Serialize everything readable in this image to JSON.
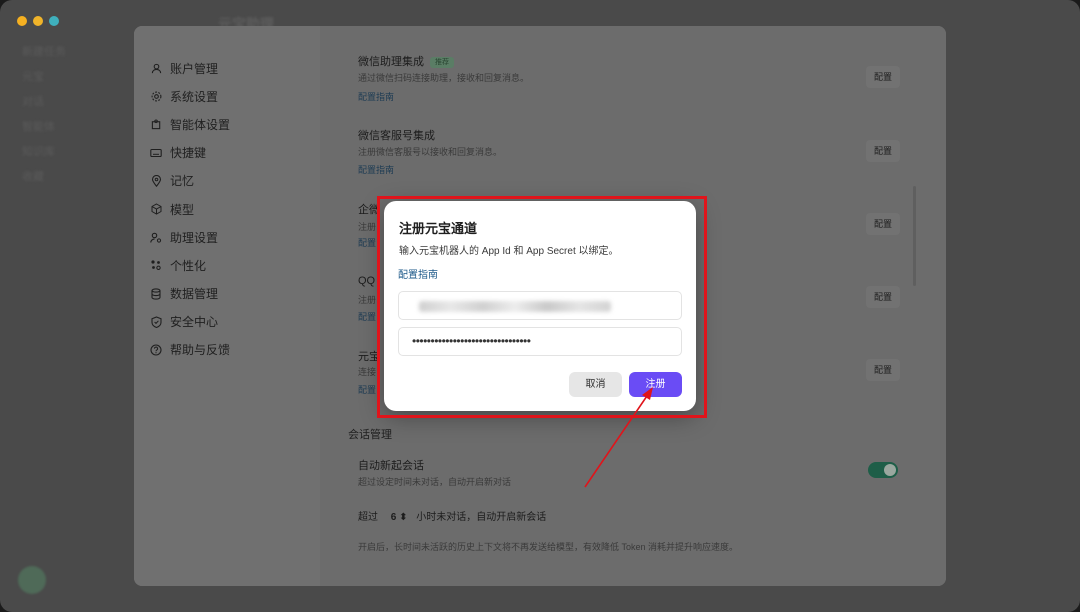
{
  "window": {
    "traffic_lights": [
      "#f5b021",
      "#f0b42a",
      "#3fb0bd"
    ],
    "title": "元宝助理"
  },
  "background_sidebar": {
    "items": [
      "新建任务",
      "元宝",
      "对话",
      "智能体",
      "知识库",
      "收藏",
      "",
      ""
    ]
  },
  "settings": {
    "nav": [
      {
        "icon": "user-icon",
        "label": "账户管理"
      },
      {
        "icon": "gear-icon",
        "label": "系统设置"
      },
      {
        "icon": "puzzle-icon",
        "label": "智能体设置"
      },
      {
        "icon": "keyboard-icon",
        "label": "快捷键"
      },
      {
        "icon": "pin-icon",
        "label": "记忆"
      },
      {
        "icon": "cube-icon",
        "label": "模型"
      },
      {
        "icon": "assistant-icon",
        "label": "助理设置"
      },
      {
        "icon": "palette-icon",
        "label": "个性化"
      },
      {
        "icon": "database-icon",
        "label": "数据管理"
      },
      {
        "icon": "shield-icon",
        "label": "安全中心"
      },
      {
        "icon": "help-icon",
        "label": "帮助与反馈"
      }
    ],
    "close_label": "×",
    "cards": [
      {
        "title": "微信助理集成",
        "tag": "推荐",
        "desc": "通过微信扫码连接助理，接收和回复消息。",
        "link": "配置指南",
        "button": "配置"
      },
      {
        "title": "微信客服号集成",
        "tag": "",
        "desc": "注册微信客服号以接收和回复消息。",
        "link": "配置指南",
        "button": "配置"
      },
      {
        "title": "企微",
        "tag": "",
        "desc": "注册",
        "link": "配置",
        "button": "配置"
      },
      {
        "title": "QQ",
        "tag": "",
        "desc": "注册",
        "link": "配置",
        "button": "配置"
      },
      {
        "title": "元宝",
        "tag": "",
        "desc": "连接",
        "link": "配置",
        "button": "配置"
      }
    ],
    "session_section": "会话管理",
    "auto_session": {
      "title": "自动新起会话",
      "desc": "超过设定时间未对话，自动开启新对话",
      "toggle_on": true,
      "prefix": "超过",
      "hours": "6",
      "suffix": "小时未对话，自动开启新会话",
      "note": "开启后，长时间未活跃的历史上下文将不再发送给模型，有效降低 Token 消耗并提升响应速度。"
    }
  },
  "dialog": {
    "title": "注册元宝通道",
    "description": "输入元宝机器人的 App Id 和 App Secret 以绑定。",
    "guide_link": "配置指南",
    "app_id_value": "",
    "app_secret_value": "••••••••••••••••••••••••••••••••",
    "cancel_label": "取消",
    "register_label": "注册",
    "accent_color": "#6a4cf5"
  },
  "annotation": {
    "highlight_color": "#e0141b"
  }
}
